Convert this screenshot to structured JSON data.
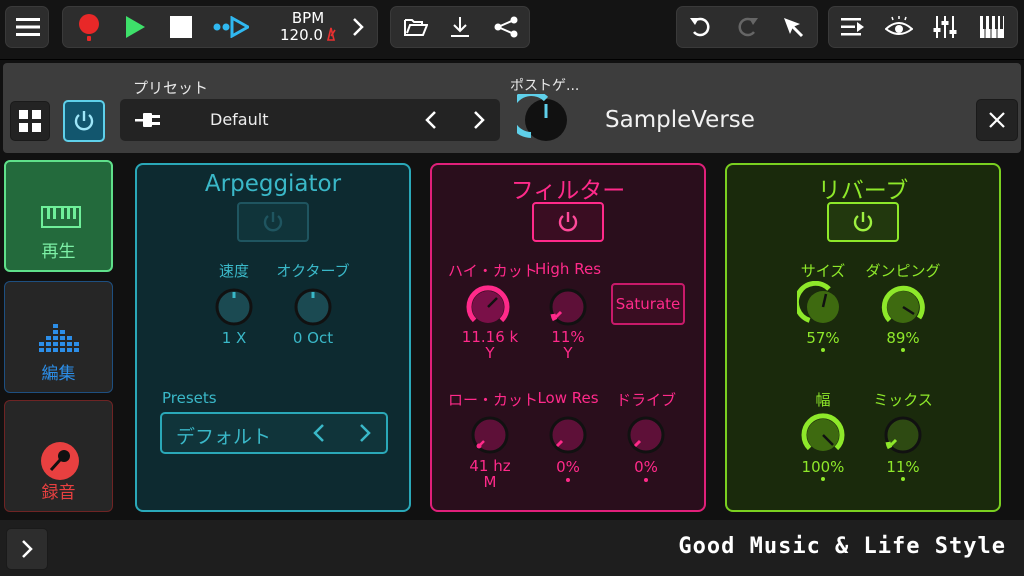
{
  "toolbar": {
    "bpm_label": "BPM",
    "bpm_value": "120.0"
  },
  "header": {
    "preset_label": "プリセット",
    "preset_name": "Default",
    "post_gain_label": "ポストゲ...",
    "plugin_name": "SampleVerse"
  },
  "sidebar": {
    "tabs": [
      {
        "label": "再生",
        "color": "#5fe08a"
      },
      {
        "label": "編集",
        "color": "#2c8ee8"
      },
      {
        "label": "録音",
        "color": "#e84040"
      }
    ]
  },
  "arp": {
    "title": "Arpeggiator",
    "color": "#3ab8c8",
    "speed_label": "速度",
    "speed_value": "1 X",
    "octave_label": "オクターブ",
    "octave_value": "0 Oct",
    "presets_label": "Presets",
    "preset_value": "デフォルト"
  },
  "filter": {
    "title": "フィルター",
    "color": "#ff2a8a",
    "hicut_label": "ハイ・カット",
    "hicut_value": "11.16 k",
    "hicut_unit": "Y",
    "hires_label": "High Res",
    "hires_value": "11%",
    "hires_unit": "Y",
    "saturate_label": "Saturate",
    "locut_label": "ロー・カット",
    "locut_value": "41 hz",
    "locut_unit": "M",
    "lores_label": "Low Res",
    "lores_value": "0%",
    "drive_label": "ドライブ",
    "drive_value": "0%"
  },
  "reverb": {
    "title": "リバーブ",
    "color": "#8ee82a",
    "size_label": "サイズ",
    "size_value": "57%",
    "damping_label": "ダンピング",
    "damping_value": "89%",
    "width_label": "幅",
    "width_value": "100%",
    "mix_label": "ミックス",
    "mix_value": "11%"
  },
  "bottom": {
    "slogan": "Good Music & Life Style"
  }
}
